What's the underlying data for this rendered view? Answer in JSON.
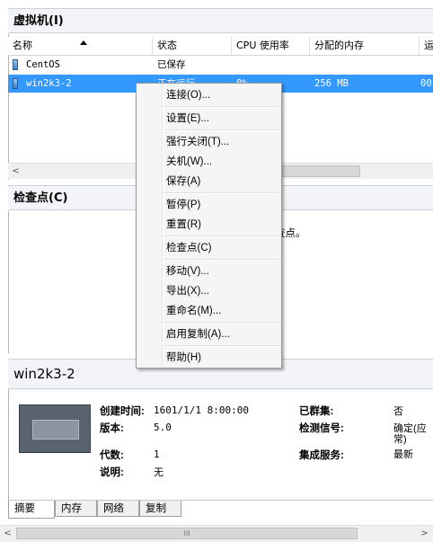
{
  "vm_section": {
    "title": "虚拟机(I)"
  },
  "columns": [
    "名称",
    "状态",
    "CPU 使用率",
    "分配的内存",
    "运"
  ],
  "vms": [
    {
      "name": "CentOS",
      "status": "已保存",
      "cpu": "",
      "memory": "",
      "uptime": ""
    },
    {
      "name": "win2k3-2",
      "status": "正在运行",
      "cpu": "0%",
      "memory": "256 MB",
      "uptime": "00"
    }
  ],
  "checkpoint_section": {
    "title": "检查点(C)",
    "empty_text_visible": "查点。"
  },
  "context_menu": {
    "items": [
      {
        "label": "连接(O)..."
      },
      {
        "label": "设置(E)..."
      },
      {
        "label": "强行关闭(T)..."
      },
      {
        "label": "关机(W)..."
      },
      {
        "label": "保存(A)"
      },
      {
        "label": "暂停(P)"
      },
      {
        "label": "重置(R)"
      },
      {
        "label": "检查点(C)"
      },
      {
        "label": "移动(V)..."
      },
      {
        "label": "导出(X)..."
      },
      {
        "label": "重命名(M)..."
      },
      {
        "label": "启用复制(A)..."
      },
      {
        "label": "帮助(H)"
      }
    ]
  },
  "details": {
    "title": "win2k3-2",
    "created_label": "创建时间:",
    "created_value": "1601/1/1 8:00:00",
    "version_label": "版本:",
    "version_value": "5.0",
    "generation_label": "代数:",
    "generation_value": "1",
    "notes_label": "说明:",
    "notes_value": "无",
    "clustered_label": "已群集:",
    "clustered_value": "否",
    "heartbeat_label": "检测信号:",
    "heartbeat_value_1": "确定(应",
    "heartbeat_value_2": "常)",
    "integration_label": "集成服务:",
    "integration_value": "最新"
  },
  "tabs": [
    {
      "label": "摘要"
    },
    {
      "label": "内存"
    },
    {
      "label": "网络"
    },
    {
      "label": "复制"
    }
  ],
  "scrollbar": {
    "grip": "III"
  }
}
